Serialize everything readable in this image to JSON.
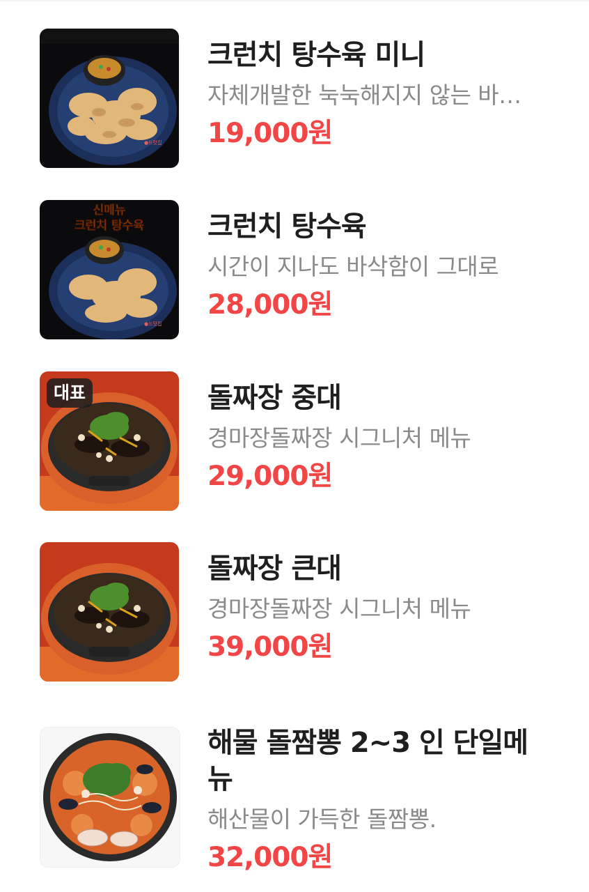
{
  "colors": {
    "price": "#f24646",
    "name": "#1f1f1f",
    "description": "#8a8a8a",
    "badge_bg": "#1e1e1e"
  },
  "menu_items": [
    {
      "name": "크런치 탕수육 미니",
      "description": "자체개발한 눅눅해지지 않는 바삭한 탕수육",
      "price": "19,000원",
      "image_icon": "crunchy-sweet-sour-pork-photo",
      "image_caption": "",
      "badge": ""
    },
    {
      "name": "크런치 탕수육",
      "description": "시간이 지나도 바삭함이 그대로",
      "price": "28,000원",
      "image_icon": "crunchy-sweet-sour-pork-photo",
      "image_caption": "신메뉴 크런치 탕수육",
      "badge": ""
    },
    {
      "name": "돌짜장 중대",
      "description": "경마장돌짜장 시그니처 메뉴",
      "price": "29,000원",
      "image_icon": "stone-pot-jjajang-photo",
      "image_caption": "",
      "badge": "대표"
    },
    {
      "name": "돌짜장 큰대",
      "description": "경마장돌짜장 시그니처 메뉴",
      "price": "39,000원",
      "image_icon": "stone-pot-jjajang-photo",
      "image_caption": "",
      "badge": ""
    },
    {
      "name": "해물 돌짬뽕 2~3 인 단일메뉴",
      "description": "해산물이 가득한 돌짬뽕.",
      "price": "32,000원",
      "image_icon": "seafood-jjamppong-photo",
      "image_caption": "",
      "badge": ""
    }
  ]
}
